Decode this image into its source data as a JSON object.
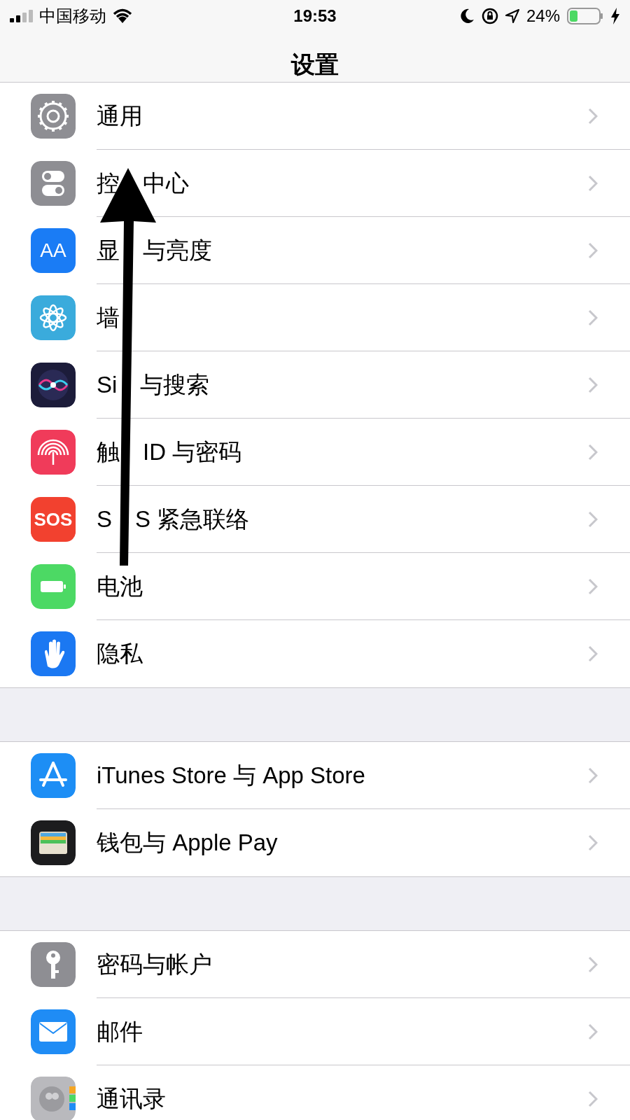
{
  "status_bar": {
    "carrier": "中国移动",
    "time": "19:53",
    "battery_percent": "24%",
    "charging": true
  },
  "nav": {
    "title": "设置"
  },
  "groups": [
    {
      "rows": [
        {
          "label": [
            "通用"
          ],
          "kind": "gear"
        },
        {
          "label": [
            "控",
            "中心"
          ],
          "kind": "toggles"
        },
        {
          "label": [
            "显",
            "与亮度"
          ],
          "kind": "text",
          "icon_text": "AA"
        },
        {
          "label": [
            "墙"
          ],
          "kind": "flower"
        },
        {
          "label": [
            "Si",
            "与搜索"
          ],
          "kind": "siri"
        },
        {
          "label": [
            "触",
            "ID 与密码"
          ],
          "kind": "fingerprint"
        },
        {
          "label": [
            "S",
            "S 紧急联络"
          ],
          "kind": "text",
          "icon_text": "SOS"
        },
        {
          "label": [
            "电池"
          ],
          "kind": "battery"
        },
        {
          "label": [
            "隐私"
          ],
          "kind": "hand"
        }
      ]
    },
    {
      "rows": [
        {
          "label": [
            "iTunes Store 与 App Store"
          ],
          "kind": "appstore"
        },
        {
          "label": [
            "钱包与 Apple Pay"
          ],
          "kind": "wallet"
        }
      ]
    },
    {
      "rows": [
        {
          "label": [
            "密码与帐户"
          ],
          "kind": "key"
        },
        {
          "label": [
            "邮件"
          ],
          "kind": "mail"
        },
        {
          "label": [
            "通讯录"
          ],
          "kind": "contacts"
        }
      ]
    }
  ]
}
